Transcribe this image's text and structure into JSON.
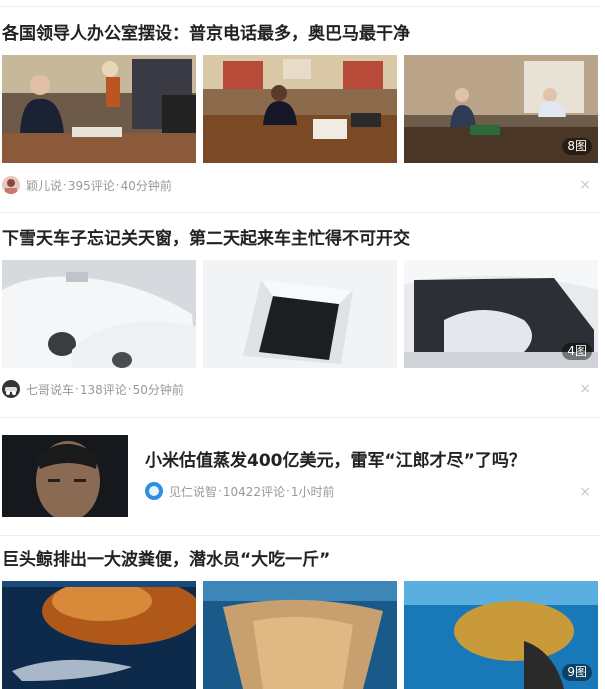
{
  "feed": [
    {
      "title": "各国领导人办公室摆设：普京电话最多，奥巴马最干净",
      "source": "颖儿说",
      "comments": "395评论",
      "time": "40分钟前",
      "image_count": "8图"
    },
    {
      "title": "下雪天车子忘记关天窗，第二天起来车主忙得不可开交",
      "source": "七哥说车",
      "comments": "138评论",
      "time": "50分钟前",
      "image_count": "4图"
    },
    {
      "title": "小米估值蒸发400亿美元，雷军“江郎才尽”了吗？",
      "source": "见仁说智",
      "comments": "10422评论",
      "time": "1小时前"
    },
    {
      "title": "巨头鲸排出一大波粪便，潜水员“大吃一斤”",
      "image_count": "9图"
    }
  ],
  "dismiss_glyph": "×",
  "dot": "·",
  "colors": {
    "text": "#222222",
    "meta": "#999999",
    "divider": "#eeeeee"
  }
}
